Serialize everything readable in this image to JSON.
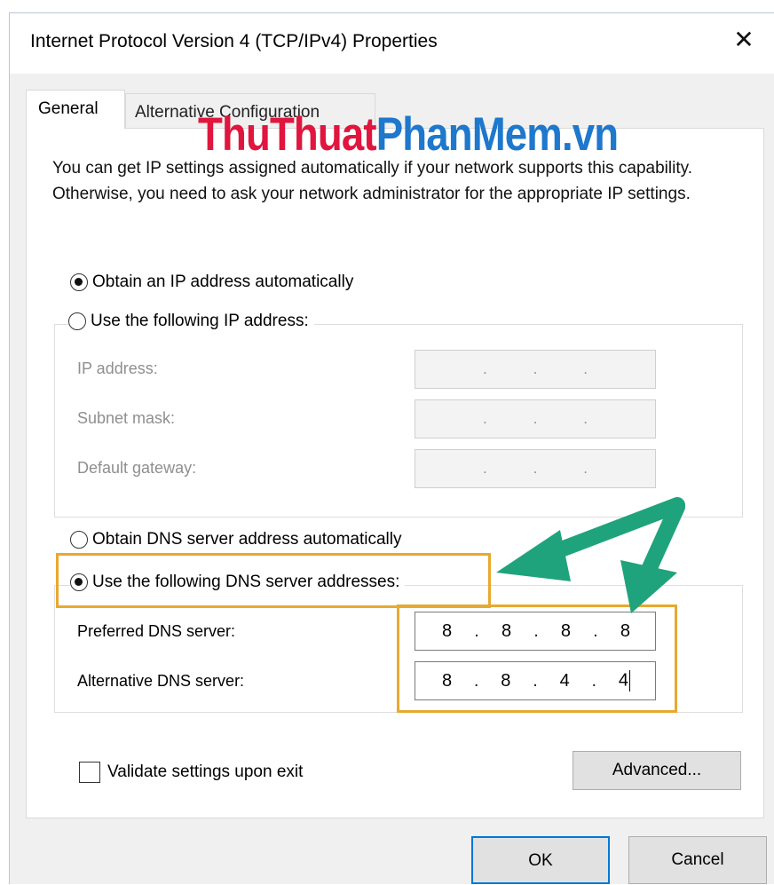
{
  "window": {
    "title": "Internet Protocol Version 4 (TCP/IPv4) Properties",
    "close_glyph": "✕"
  },
  "tabs": [
    {
      "label": "General",
      "active": true
    },
    {
      "label": "Alternative Configuration",
      "active": false
    }
  ],
  "watermark": {
    "part1": "ThuThuat",
    "part2": "PhanMem.vn"
  },
  "description": "You can get IP settings assigned automatically if your network supports this capability. Otherwise, you need to ask your network administrator for the appropriate IP settings.",
  "ip_options": {
    "auto_label": "Obtain an IP address automatically",
    "manual_label": "Use the following IP address:",
    "selected": "auto",
    "fields": [
      {
        "label": "IP address:",
        "value": ". . ."
      },
      {
        "label": "Subnet mask:",
        "value": ". . ."
      },
      {
        "label": "Default gateway:",
        "value": ". . ."
      }
    ]
  },
  "dns_options": {
    "auto_label": "Obtain DNS server address automatically",
    "manual_label": "Use the following DNS server addresses:",
    "selected": "manual",
    "preferred": {
      "label": "Preferred DNS server:",
      "octets": [
        "8",
        "8",
        "8",
        "8"
      ]
    },
    "alternative": {
      "label": "Alternative DNS server:",
      "octets": [
        "8",
        "8",
        "4",
        "4"
      ]
    }
  },
  "validate": {
    "label": "Validate settings upon exit",
    "checked": false
  },
  "buttons": {
    "advanced": "Advanced...",
    "ok": "OK",
    "cancel": "Cancel"
  },
  "colors": {
    "highlight": "#e8a930",
    "arrow": "#1fa37c",
    "watermark_red": "#e0163f",
    "watermark_blue": "#1e78cc",
    "ok_border": "#0078d7"
  }
}
